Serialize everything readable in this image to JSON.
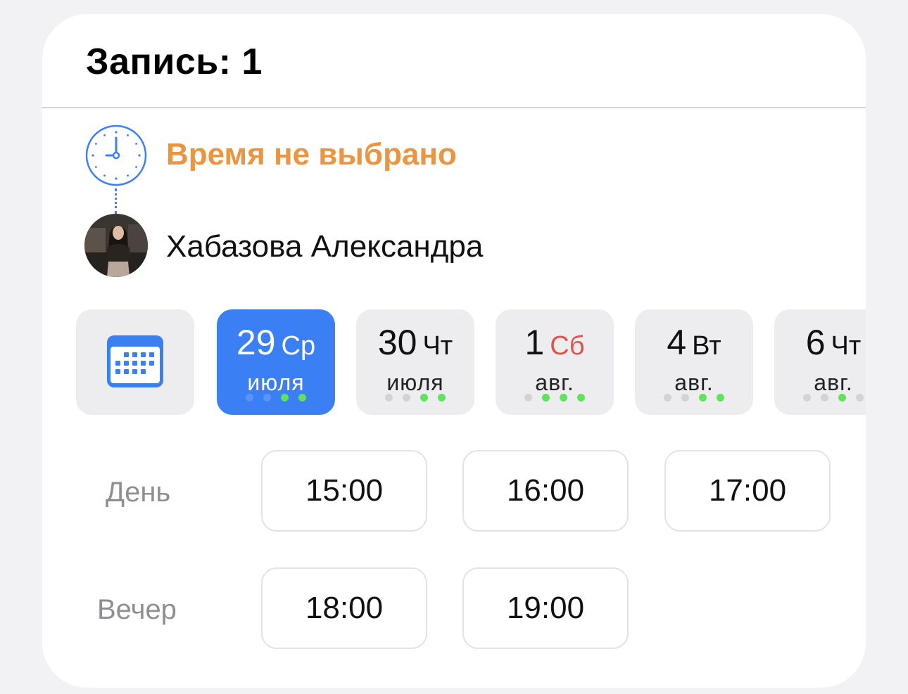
{
  "header": {
    "title": "Запись: 1"
  },
  "booking": {
    "time_status": "Время не выбрано",
    "status_color": "#eb9540",
    "specialist_name": "Хабазова Александра"
  },
  "calendar_button": {
    "icon": "calendar-icon"
  },
  "dates": [
    {
      "day": "29",
      "weekday": "Ср",
      "month": "июля",
      "selected": true,
      "weekend": false,
      "dots": [
        false,
        false,
        true,
        true
      ]
    },
    {
      "day": "30",
      "weekday": "Чт",
      "month": "июля",
      "selected": false,
      "weekend": false,
      "dots": [
        false,
        false,
        true,
        true
      ]
    },
    {
      "day": "1",
      "weekday": "Сб",
      "month": "авг.",
      "selected": false,
      "weekend": true,
      "dots": [
        false,
        true,
        true,
        true
      ]
    },
    {
      "day": "4",
      "weekday": "Вт",
      "month": "авг.",
      "selected": false,
      "weekend": false,
      "dots": [
        false,
        false,
        true,
        true
      ]
    },
    {
      "day": "6",
      "weekday": "Чт",
      "month": "авг.",
      "selected": false,
      "weekend": false,
      "dots": [
        false,
        false,
        true,
        false
      ]
    }
  ],
  "periods": [
    {
      "label": "День",
      "slots": [
        "15:00",
        "16:00",
        "17:00"
      ]
    },
    {
      "label": "Вечер",
      "slots": [
        "18:00",
        "19:00"
      ]
    }
  ],
  "colors": {
    "accent": "#3b7ff5",
    "available_dot": "#5ee35c",
    "weekend": "#e0544a"
  }
}
